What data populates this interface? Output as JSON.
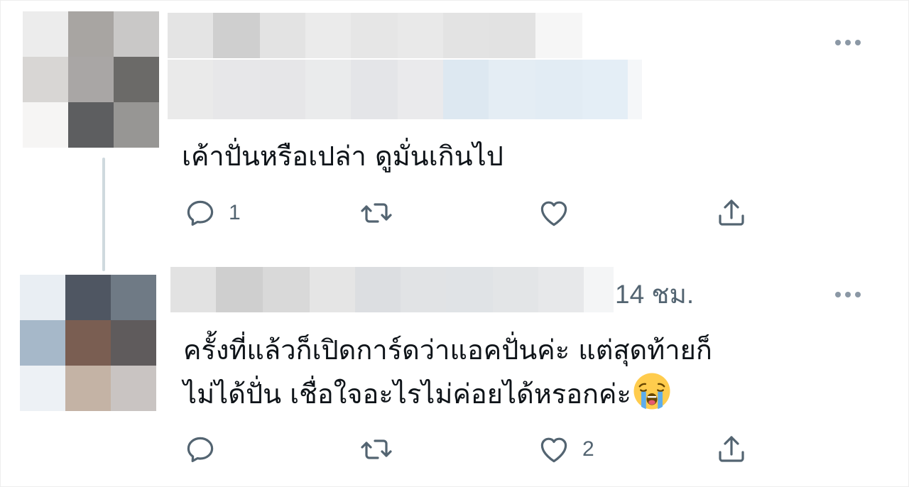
{
  "colors": {
    "icon": "#536471",
    "text": "#0f1419",
    "secondary_text": "#536471",
    "thread_line": "#cfd9de"
  },
  "tweets": [
    {
      "author_redacted": true,
      "text": "เค้าปั่นหรือเปล่า ดูมั่นเกินไป",
      "more_icon": "more-horizontal-icon",
      "actions": {
        "reply": {
          "icon": "reply-bubble-icon",
          "count": "1"
        },
        "retweet": {
          "icon": "retweet-arrows-icon",
          "count": ""
        },
        "like": {
          "icon": "heart-icon",
          "count": ""
        },
        "share": {
          "icon": "share-upload-icon",
          "count": ""
        }
      }
    },
    {
      "author_redacted": true,
      "timestamp": "14 ชม.",
      "text_line1": "ครั้งที่แล้วก็เปิดการ์ดว่าแอคปั่นค่ะ แต่สุดท้ายก็",
      "text_line2": "ไม่ได้ปั่น เชื่อใจอะไรไม่ค่อยได้หรอกค่ะ",
      "emoji": "loudly-crying-face-emoji",
      "more_icon": "more-horizontal-icon",
      "actions": {
        "reply": {
          "icon": "reply-bubble-icon",
          "count": ""
        },
        "retweet": {
          "icon": "retweet-arrows-icon",
          "count": ""
        },
        "like": {
          "icon": "heart-icon",
          "count": "2"
        },
        "share": {
          "icon": "share-upload-icon",
          "count": ""
        }
      }
    }
  ]
}
